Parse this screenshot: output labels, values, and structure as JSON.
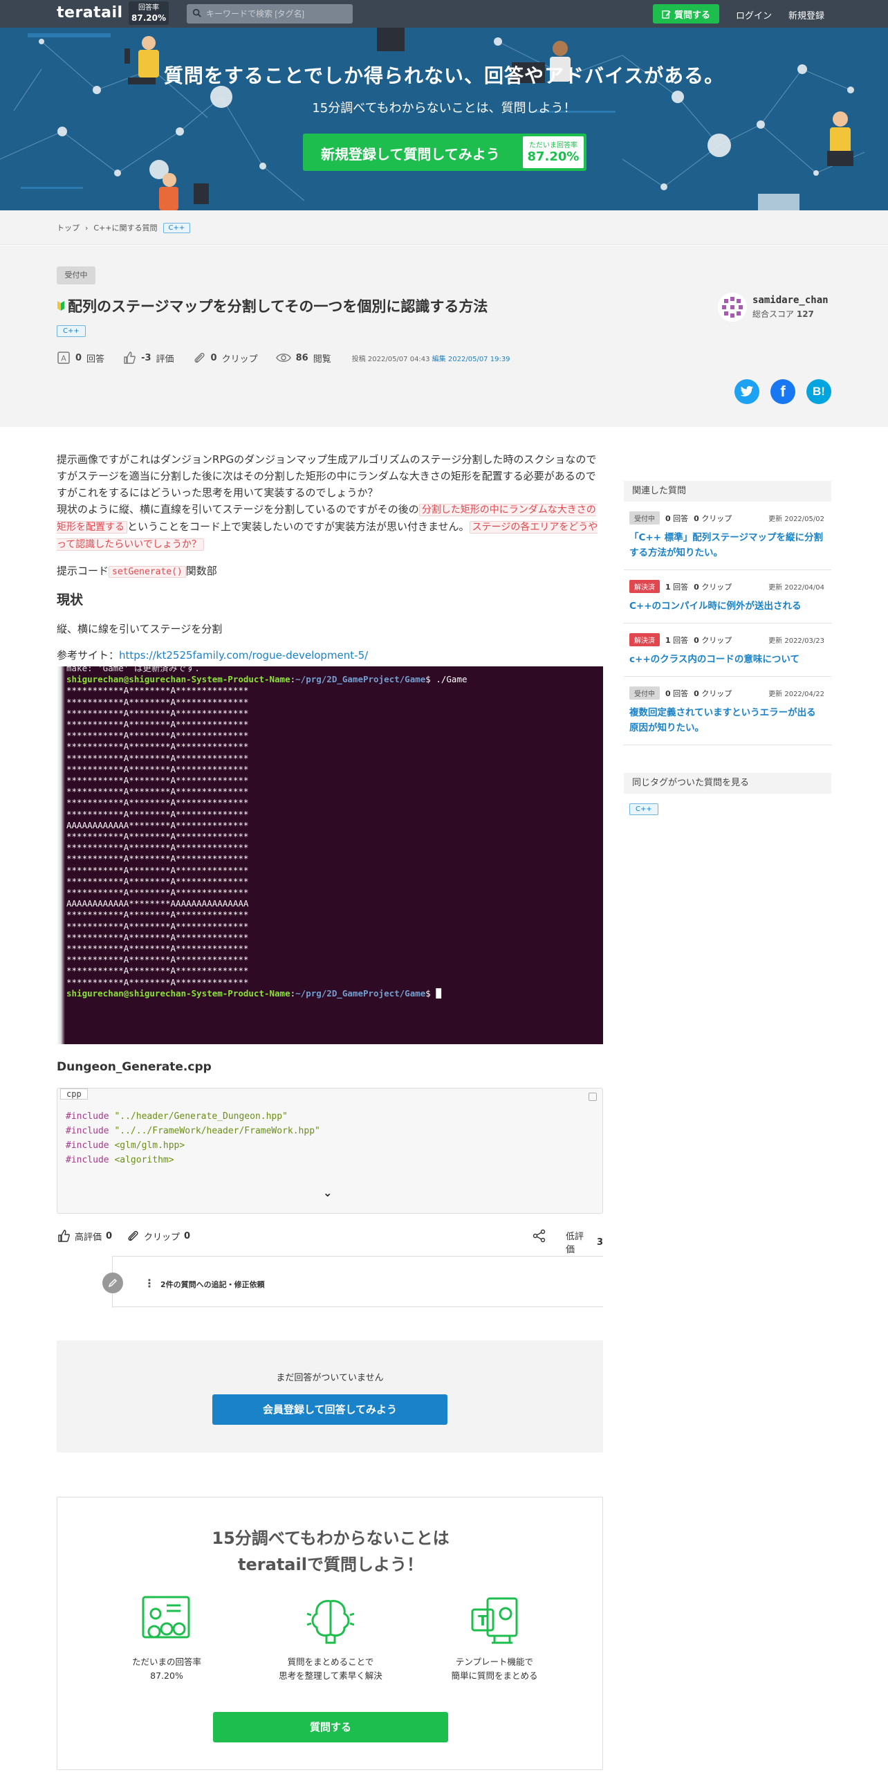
{
  "header": {
    "logo": "teratail",
    "rate_label": "回答率",
    "rate_value": "87.20%",
    "search_placeholder": "キーワードで検索 [タグ名]",
    "ask_button": "質問する",
    "login": "ログイン",
    "signup": "新規登録"
  },
  "hero": {
    "headline": "質問をすることでしか得られない、回答やアドバイスがある。",
    "subline": "15分調べてもわからないことは、質問しよう！",
    "cta_label": "新規登録して質問してみよう",
    "badge_label": "ただいま回答率",
    "badge_value": "87.20%"
  },
  "breadcrumb": {
    "top": "トップ",
    "category": "C++に関する質問",
    "tag": "C++"
  },
  "question": {
    "status": "受付中",
    "title": "配列のステージマップを分割してその一つを個別に認識する方法",
    "tag": "C++",
    "answers_count": "0",
    "answers_label": "回答",
    "score": "-3",
    "score_label": "評価",
    "clips": "0",
    "clips_label": "クリップ",
    "views": "86",
    "views_label": "閲覧",
    "posted_label": "投稿",
    "posted_at": "2022/05/07 04:43",
    "edited_label": "編集",
    "edited_at": "2022/05/07 19:39",
    "user_name": "samidare_chan",
    "user_score_label": "総合スコア",
    "user_score": "127"
  },
  "share": {
    "twitter": "t",
    "facebook": "f",
    "hatena": "B!"
  },
  "body": {
    "p1": "提示画像ですがこれはダンジョンRPGのダンジョンマップ生成アルゴリズムのステージ分割した時のスクショなのですがステージを適当に分割した後に次はその分割した矩形の中にランダムな大きさの矩形を配置する必要があるのですがこれをするにはどういった思考を用いて実装するのでしょうか？",
    "p2a": "現状のように縦、横に直線を引いてステージを分割しているのですがその後の",
    "p2_hl1": "分割した矩形の中にランダムな大きさの矩形を配置する",
    "p2b": "ということをコード上で実装したいのですが実装方法が思い付きません。",
    "p2_hl2": "ステージの各エリアをどうやって認識したらいいでしょうか？",
    "code_prefix": "提示コード",
    "code_inline": "setGenerate()",
    "code_suffix": "関数部",
    "section_title": "現状",
    "status_text": "縦、横に線を引いてステージを分割",
    "ref_label": "参考サイト：",
    "ref_url": "https://kt2525family.com/rogue-development-5/",
    "file_title": "Dungeon_Generate.cpp",
    "code_lang": "cpp"
  },
  "terminal": {
    "top_line": "make: 'Game' は更新済みです.",
    "prompt_user": "shigurechan@shigurechan-System-Product-Name",
    "prompt_path": "~/prg/2D_GameProject/Game",
    "command": "$ ./Game",
    "end_prompt": "$ ",
    "rows": [
      "***********A********A**************",
      "***********A********A**************",
      "***********A********A**************",
      "***********A********A**************",
      "***********A********A**************",
      "***********A********A**************",
      "***********A********A**************",
      "***********A********A**************",
      "***********A********A**************",
      "***********A********A**************",
      "***********A********A**************",
      "***********A********A**************",
      "AAAAAAAAAAAA********A**************",
      "***********A********A**************",
      "***********A********A**************",
      "***********A********A**************",
      "***********A********A**************",
      "***********A********A**************",
      "***********A********A**************",
      "AAAAAAAAAAAA********AAAAAAAAAAAAAAA",
      "***********A********A**************",
      "***********A********A**************",
      "***********A********A**************",
      "***********A********A**************",
      "***********A********A**************",
      "***********A********A**************",
      "***********A********A**************"
    ]
  },
  "code": {
    "lines": [
      {
        "kw": "#include",
        "arg": "\"../header/Generate_Dungeon.hpp\""
      },
      {
        "kw": "#include",
        "arg": "\"../../FrameWork/header/FrameWork.hpp\""
      },
      {
        "kw": "#include",
        "arg": "<glm/glm.hpp>"
      },
      {
        "kw": "#include",
        "arg": "<algorithm>"
      }
    ]
  },
  "actions": {
    "upvote": "高評価",
    "upvote_count": "0",
    "clip": "クリップ",
    "clip_count": "0",
    "downvote": "低評価",
    "downvote_count": "3",
    "comments_label": "2件の質問への追記・修正依頼"
  },
  "no_answer": {
    "text": "まだ回答がついていません",
    "button": "会員登録して回答してみよう"
  },
  "promo": {
    "title_line1": "15分調べてもわからないことは",
    "title_line2": "teratailで質問しよう！",
    "f1_line1": "ただいまの回答率",
    "f1_line2": "87.20%",
    "f2_line1": "質問をまとめることで",
    "f2_line2": "思考を整理して素早く解決",
    "f3_line1": "テンプレート機能で",
    "f3_line2": "簡単に質問をまとめる",
    "button": "質問する"
  },
  "sidebar": {
    "related_title": "関連した質問",
    "items": [
      {
        "status": "受付中",
        "status_type": "wait",
        "answers": "0",
        "answers_label": "回答",
        "clips": "0",
        "clips_label": "クリップ",
        "updated": "更新 2022/05/02",
        "title": "「C++ 標準」配列ステージマップを縦に分割する方法が知りたい。"
      },
      {
        "status": "解決済",
        "status_type": "done",
        "answers": "1",
        "answers_label": "回答",
        "clips": "0",
        "clips_label": "クリップ",
        "updated": "更新 2022/04/04",
        "title": "C++のコンパイル時に例外が送出される"
      },
      {
        "status": "解決済",
        "status_type": "done",
        "answers": "1",
        "answers_label": "回答",
        "clips": "0",
        "clips_label": "クリップ",
        "updated": "更新 2022/03/23",
        "title": "c++のクラス内のコードの意味について"
      },
      {
        "status": "受付中",
        "status_type": "wait",
        "answers": "0",
        "answers_label": "回答",
        "clips": "0",
        "clips_label": "クリップ",
        "updated": "更新 2022/04/22",
        "title": "複数回定義されていますというエラーが出る原因が知りたい。"
      }
    ],
    "same_tag_title": "同じタグがついた質問を見る",
    "tag": "C++"
  },
  "colors": {
    "header_bg": "#3b4652",
    "hero_bg": "#1f5f8b",
    "brand_green": "#1dbe4d",
    "link_blue": "#1a82c8",
    "solved_red": "#e0474e",
    "terminal_bg": "#2e0a24"
  }
}
